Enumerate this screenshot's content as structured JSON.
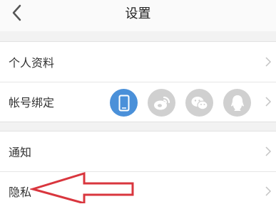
{
  "header": {
    "title": "设置",
    "back_icon": "chevron-left-icon"
  },
  "group1": {
    "items": [
      {
        "label": "个人资料",
        "icon": "chevron-right-icon"
      },
      {
        "label": "帐号绑定",
        "icon": "chevron-right-icon"
      }
    ],
    "social_accounts": [
      {
        "icon": "phone-icon",
        "status": "bound",
        "color": "#4a90d9"
      },
      {
        "icon": "weibo-icon",
        "status": "unbound",
        "color": "#d0d0d0"
      },
      {
        "icon": "wechat-icon",
        "status": "unbound",
        "color": "#d0d0d0"
      },
      {
        "icon": "qq-icon",
        "status": "unbound",
        "color": "#d0d0d0"
      }
    ]
  },
  "group2": {
    "items": [
      {
        "label": "通知",
        "icon": "chevron-right-icon"
      },
      {
        "label": "隐私",
        "icon": "chevron-right-icon"
      }
    ]
  },
  "annotation": {
    "icon": "red-arrow-icon",
    "color": "#d9363e"
  }
}
